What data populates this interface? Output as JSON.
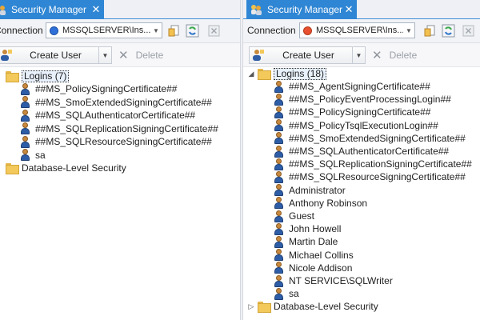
{
  "colors": {
    "tab_bg": "#2f86d4",
    "status_blue": "#2e6fd8",
    "status_red": "#e8502f",
    "user_body": "#2d5da6",
    "folder": "#f2c95a"
  },
  "left": {
    "tab": {
      "label": "Security Manager",
      "close": "✕"
    },
    "connection": {
      "label": "Connection",
      "value": "MSSQLSERVER\\Ins...",
      "status": "blue"
    },
    "toolbar": {
      "create_user": "Create User",
      "delete": "Delete"
    },
    "logins": {
      "label": "Logins (7)",
      "expanded": true,
      "expander": "",
      "items": [
        "##MS_PolicySigningCertificate##",
        "##MS_SmoExtendedSigningCertificate##",
        "##MS_SQLAuthenticatorCertificate##",
        "##MS_SQLReplicationSigningCertificate##",
        "##MS_SQLResourceSigningCertificate##",
        "sa"
      ]
    },
    "db_security": {
      "label": "Database-Level Security",
      "expander": ""
    }
  },
  "right": {
    "tab": {
      "label": "Security Manager",
      "close": "✕"
    },
    "connection": {
      "label": "Connection",
      "value": "MSSQLSERVER\\Ins...",
      "status": "red"
    },
    "toolbar": {
      "create_user": "Create User",
      "delete": "Delete"
    },
    "logins": {
      "label": "Logins (18)",
      "expanded": true,
      "expander": "◢",
      "items": [
        "##MS_AgentSigningCertificate##",
        "##MS_PolicyEventProcessingLogin##",
        "##MS_PolicySigningCertificate##",
        "##MS_PolicyTsqlExecutionLogin##",
        "##MS_SmoExtendedSigningCertificate##",
        "##MS_SQLAuthenticatorCertificate##",
        "##MS_SQLReplicationSigningCertificate##",
        "##MS_SQLResourceSigningCertificate##",
        "Administrator",
        "Anthony Robinson",
        "Guest",
        "John Howell",
        "Martin Dale",
        "Michael Collins",
        "Nicole Addison",
        "NT SERVICE\\SQLWriter",
        "sa"
      ]
    },
    "db_security": {
      "label": "Database-Level Security",
      "expander": "▷"
    }
  }
}
